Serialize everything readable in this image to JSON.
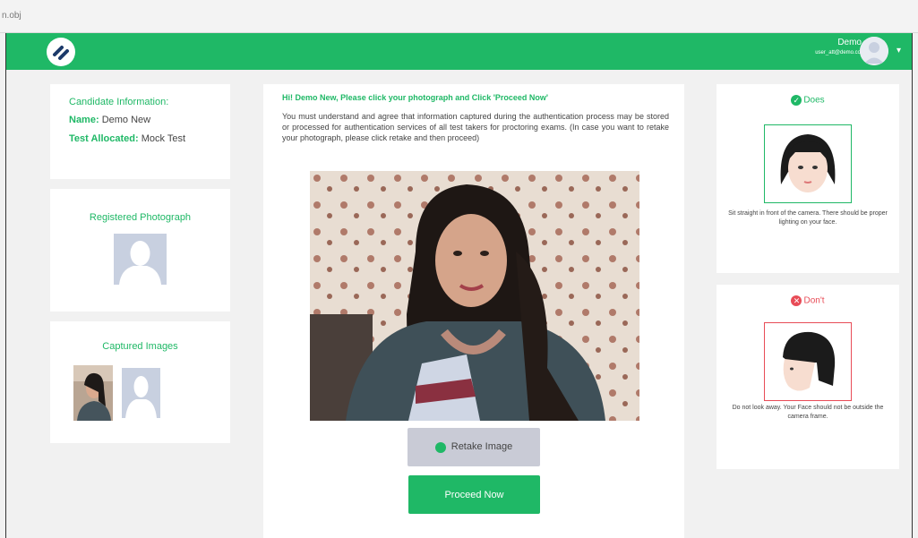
{
  "browser": {
    "tab_text": "n.obj"
  },
  "header": {
    "user_name": "Demo",
    "user_email": "user_att@demo.com",
    "caret": "▾"
  },
  "candidate": {
    "title": "Candidate Information:",
    "name_label": "Name:",
    "name_value": "Demo New",
    "test_label": "Test Allocated:",
    "test_value": "Mock Test"
  },
  "registered": {
    "title": "Registered Photograph"
  },
  "captured": {
    "title": "Captured Images"
  },
  "main": {
    "title": "Hi! Demo New, Please click your photograph and Click 'Proceed Now'",
    "body": "You must understand and agree that information captured during the authentication process may be stored or processed for authentication services of all test takers for proctoring exams. (In case you want to retake your photograph, please click retake and then proceed)",
    "retake_label": "Retake Image",
    "proceed_label": "Proceed Now"
  },
  "guide": {
    "do_title": "Does",
    "do_text": "Sit straight in front of the camera. There should be proper lighting on your face.",
    "dont_title": "Don't",
    "dont_text": "Do not look away. Your Face should not be outside the camera frame."
  },
  "colors": {
    "accent": "#1fb866",
    "danger": "#e84c57",
    "placeholder": "#c8d0e0"
  }
}
